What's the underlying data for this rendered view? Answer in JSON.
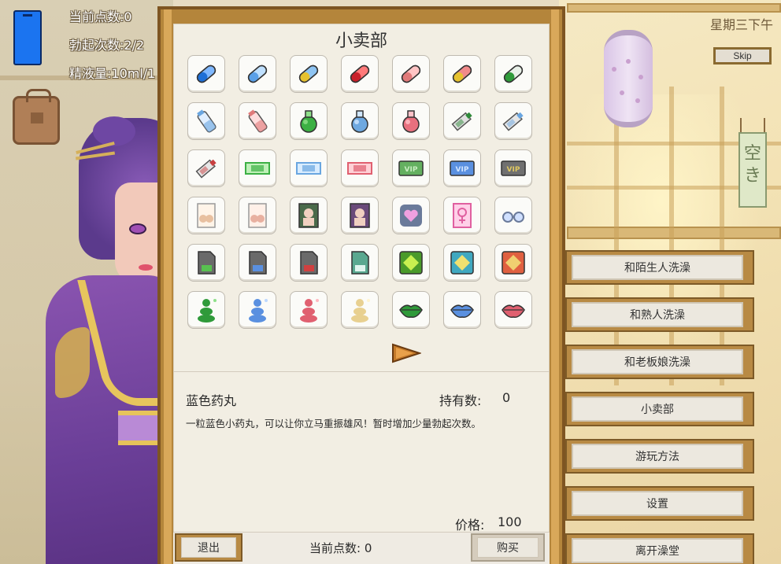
{
  "hud": {
    "points": "当前点数:0",
    "erections": "勃起次数:2/2",
    "semen": "精液量:10ml/1",
    "day": "星期三下午",
    "skip": "Skip"
  },
  "banner_text": "空き",
  "side_menu": [
    {
      "label": "和陌生人洗澡",
      "name": "menu-bathe-stranger"
    },
    {
      "label": "和熟人洗澡",
      "name": "menu-bathe-acquaintance"
    },
    {
      "label": "和老板娘洗澡",
      "name": "menu-bathe-proprietress"
    },
    {
      "label": "小卖部",
      "name": "menu-shop"
    },
    {
      "label": "游玩方法",
      "name": "menu-how-to-play"
    },
    {
      "label": "设置",
      "name": "menu-settings"
    },
    {
      "label": "离开澡堂",
      "name": "menu-leave-bathhouse"
    }
  ],
  "shop": {
    "title": "小卖部",
    "selected_item_name": "蓝色药丸",
    "owned_label": "持有数:",
    "owned_value": "0",
    "description": "一粒蓝色小药丸，可以让你立马重振雄风！暂时增加少量勃起次数。",
    "price_label": "价格:",
    "price_value": "100",
    "exit_label": "退出",
    "points_label": "当前点数: 0",
    "buy_label": "购买",
    "items": [
      {
        "icon": "blue-pill",
        "c1": "#1e6fd6",
        "c2": "#7fb8ff"
      },
      {
        "icon": "light-blue-pill",
        "c1": "#5aa0e8",
        "c2": "#bfe0ff"
      },
      {
        "icon": "yellow-blue-pill",
        "c1": "#e6c230",
        "c2": "#8ec4f2"
      },
      {
        "icon": "red-pill",
        "c1": "#c8202a",
        "c2": "#ff7a7a"
      },
      {
        "icon": "pink-pill",
        "c1": "#e07a7a",
        "c2": "#ffc4c4"
      },
      {
        "icon": "yellow-pink-pill",
        "c1": "#e6c230",
        "c2": "#f08a8a"
      },
      {
        "icon": "green-pill",
        "c1": "#2f9a3a",
        "c2": "#e8f0e8"
      },
      {
        "icon": "blue-bottle",
        "c1": "#6aa6e0",
        "c2": "#dfeeff"
      },
      {
        "icon": "pink-bottle",
        "c1": "#e07a7a",
        "c2": "#ffdcdc"
      },
      {
        "icon": "green-potion",
        "c1": "#3cb044",
        "c2": "#8fe08a"
      },
      {
        "icon": "blue-potion",
        "c1": "#6ea8e0",
        "c2": "#cfe6ff"
      },
      {
        "icon": "pink-potion",
        "c1": "#e8707e",
        "c2": "#ffc2c8"
      },
      {
        "icon": "green-tube",
        "c1": "#2f8a3a",
        "c2": "#e0e0e0"
      },
      {
        "icon": "blue-tube",
        "c1": "#6aa6e0",
        "c2": "#e6e6e6"
      },
      {
        "icon": "red-tube",
        "c1": "#c84040",
        "c2": "#e6e6e6"
      },
      {
        "icon": "green-ticket",
        "c1": "#3cb044",
        "c2": "#bff0b8"
      },
      {
        "icon": "blue-ticket",
        "c1": "#6aa6e0",
        "c2": "#d8ecff"
      },
      {
        "icon": "red-ticket",
        "c1": "#e06070",
        "c2": "#ffd0d6"
      },
      {
        "icon": "green-vip-card",
        "c1": "#64b060",
        "c2": "#c8ecc0"
      },
      {
        "icon": "blue-vip-card",
        "c1": "#5a90e0",
        "c2": "#d0e4ff"
      },
      {
        "icon": "gray-vip-card",
        "c1": "#707070",
        "c2": "#e0c860"
      },
      {
        "icon": "e-cup-card",
        "c1": "#e8c0a0",
        "c2": "#fff4e8"
      },
      {
        "icon": "g-cup-card",
        "c1": "#e8b0a0",
        "c2": "#fff0e8"
      },
      {
        "icon": "portrait-card-1",
        "c1": "#4a6a4a",
        "c2": "#f0d0c0"
      },
      {
        "icon": "portrait-card-2",
        "c1": "#6a4a7a",
        "c2": "#f0d0c0"
      },
      {
        "icon": "heart-card",
        "c1": "#6a7a9a",
        "c2": "#f0a0e0"
      },
      {
        "icon": "female-symbol-book",
        "c1": "#e060a0",
        "c2": "#ffd0e8"
      },
      {
        "icon": "glasses",
        "c1": "#6a7a9a",
        "c2": "#d0e0ff"
      },
      {
        "icon": "green-sd-card",
        "c1": "#6a6a6a",
        "c2": "#58c050"
      },
      {
        "icon": "blue-sd-card",
        "c1": "#6a6a6a",
        "c2": "#5a90e0"
      },
      {
        "icon": "red-sd-card",
        "c1": "#6a6a6a",
        "c2": "#d04040"
      },
      {
        "icon": "cloud-sd-card",
        "c1": "#5aa890",
        "c2": "#e0f4ee"
      },
      {
        "icon": "lime-box",
        "c1": "#4a9a2a",
        "c2": "#c8f050"
      },
      {
        "icon": "cyan-box",
        "c1": "#40a8c0",
        "c2": "#f0e070"
      },
      {
        "icon": "orange-box",
        "c1": "#e06040",
        "c2": "#f0d070"
      },
      {
        "icon": "green-figure",
        "c1": "#2f9a3a",
        "c2": "#8fe08a"
      },
      {
        "icon": "blue-figure",
        "c1": "#5a90e0",
        "c2": "#bcd8ff"
      },
      {
        "icon": "red-figure",
        "c1": "#e06070",
        "c2": "#ffb8c0"
      },
      {
        "icon": "cream-figure",
        "c1": "#e8d090",
        "c2": "#fff4d0"
      },
      {
        "icon": "green-lips",
        "c1": "#2f9a3a",
        "c2": "#8fe08a"
      },
      {
        "icon": "blue-lips",
        "c1": "#5a90e0",
        "c2": "#bcd8ff"
      },
      {
        "icon": "pink-lips",
        "c1": "#e06070",
        "c2": "#ffb8c0"
      }
    ]
  }
}
